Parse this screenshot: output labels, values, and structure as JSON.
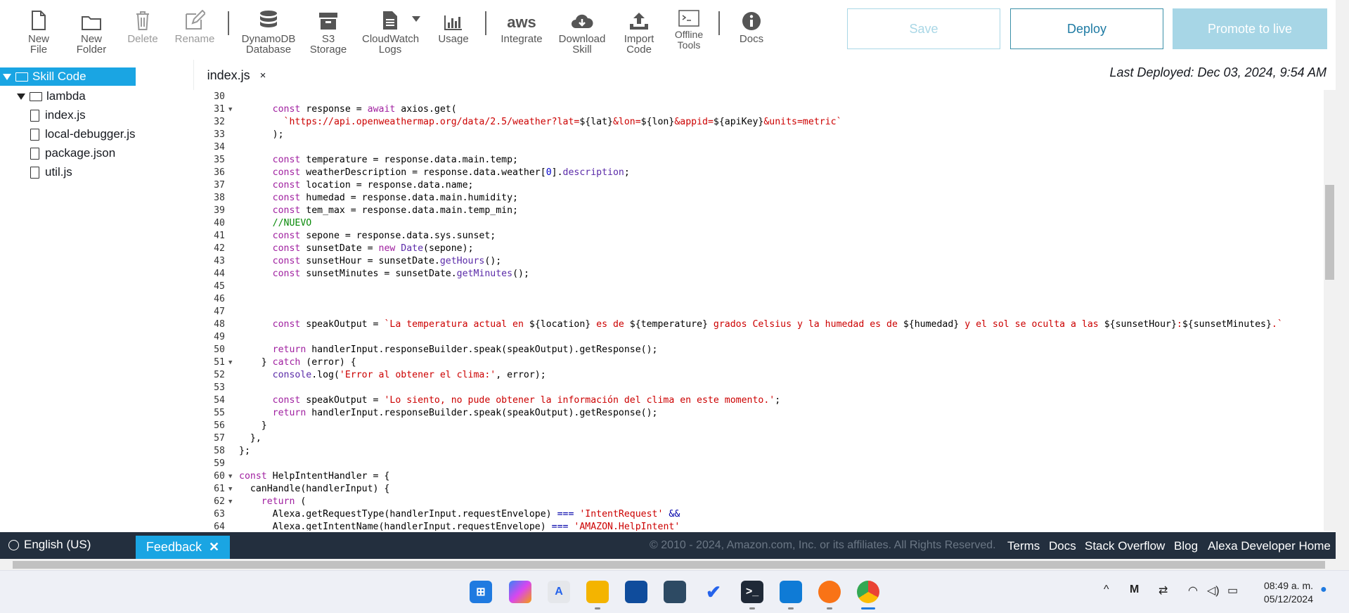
{
  "toolbar": {
    "new_file": "New\nFile",
    "new_folder": "New\nFolder",
    "delete": "Delete",
    "rename": "Rename",
    "dynamodb": "DynamoDB\nDatabase",
    "s3": "S3\nStorage",
    "cloudwatch": "CloudWatch\nLogs",
    "usage": "Usage",
    "integrate": "Integrate",
    "aws_logo_text": "aws",
    "download": "Download\nSkill",
    "import": "Import\nCode",
    "offline": "Offline\nTools",
    "docs": "Docs",
    "save": "Save",
    "deploy": "Deploy",
    "promote": "Promote to live"
  },
  "tree": {
    "root": "Skill Code",
    "folder": "lambda",
    "files": [
      "index.js",
      "local-debugger.js",
      "package.json",
      "util.js"
    ]
  },
  "editor": {
    "tab": "index.js",
    "tab_close": "×",
    "last_deployed": "Last Deployed: Dec 03, 2024, 9:54 AM",
    "lines": [
      {
        "n": "30",
        "fold": false,
        "html": ""
      },
      {
        "n": "31",
        "fold": true,
        "html": "      <span class='k'>const</span> response = <span class='k'>await</span> axios.get("
      },
      {
        "n": "32",
        "fold": false,
        "html": "        <span class='s'>`https://api.openweathermap.org/data/2.5/weather?lat=</span>${lat}<span class='s'>&amp;lon=</span>${lon}<span class='s'>&amp;appid=</span>${apiKey}<span class='s'>&amp;units=metric`</span>"
      },
      {
        "n": "33",
        "fold": false,
        "html": "      );"
      },
      {
        "n": "34",
        "fold": false,
        "html": ""
      },
      {
        "n": "35",
        "fold": false,
        "html": "      <span class='k'>const</span> temperature = response.data.main.temp;"
      },
      {
        "n": "36",
        "fold": false,
        "html": "      <span class='k'>const</span> weatherDescription = response.data.weather[<span class='n'>0</span>].<span class='f'>description</span>;"
      },
      {
        "n": "37",
        "fold": false,
        "html": "      <span class='k'>const</span> location = response.data.name;"
      },
      {
        "n": "38",
        "fold": false,
        "html": "      <span class='k'>const</span> humedad = response.data.main.humidity;"
      },
      {
        "n": "39",
        "fold": false,
        "html": "      <span class='k'>const</span> tem_max = response.data.main.temp_min;"
      },
      {
        "n": "40",
        "fold": false,
        "html": "      <span class='c'>//NUEVO</span>"
      },
      {
        "n": "41",
        "fold": false,
        "html": "      <span class='k'>const</span> sepone = response.data.sys.sunset;"
      },
      {
        "n": "42",
        "fold": false,
        "html": "      <span class='k'>const</span> sunsetDate = <span class='k'>new</span> <span class='f'>Date</span>(sepone);"
      },
      {
        "n": "43",
        "fold": false,
        "html": "      <span class='k'>const</span> sunsetHour = sunsetDate.<span class='f'>getHours</span>();"
      },
      {
        "n": "44",
        "fold": false,
        "html": "      <span class='k'>const</span> sunsetMinutes = sunsetDate.<span class='f'>getMinutes</span>();"
      },
      {
        "n": "45",
        "fold": false,
        "html": ""
      },
      {
        "n": "46",
        "fold": false,
        "html": ""
      },
      {
        "n": "47",
        "fold": false,
        "html": ""
      },
      {
        "n": "48",
        "fold": false,
        "html": "      <span class='k'>const</span> speakOutput = <span class='s'>`La temperatura actual en </span>${location}<span class='s'> es de </span>${temperature}<span class='s'> grados Celsius y la humedad es de </span>${humedad}<span class='s'> y el sol se oculta a las </span>${sunsetHour}<span class='s'>:</span>${sunsetMinutes}<span class='s'>.`</span>"
      },
      {
        "n": "49",
        "fold": false,
        "html": ""
      },
      {
        "n": "50",
        "fold": false,
        "html": "      <span class='k'>return</span> handlerInput.responseBuilder.speak(speakOutput).getResponse();"
      },
      {
        "n": "51",
        "fold": true,
        "html": "    } <span class='k'>catch</span> (error) {"
      },
      {
        "n": "52",
        "fold": false,
        "html": "      <span class='f'>console</span>.log(<span class='s'>'Error al obtener el clima:'</span>, error);"
      },
      {
        "n": "53",
        "fold": false,
        "html": ""
      },
      {
        "n": "54",
        "fold": false,
        "html": "      <span class='k'>const</span> speakOutput = <span class='s'>'Lo siento, no pude obtener la información del clima en este momento.'</span>;"
      },
      {
        "n": "55",
        "fold": false,
        "html": "      <span class='k'>return</span> handlerInput.responseBuilder.speak(speakOutput).getResponse();"
      },
      {
        "n": "56",
        "fold": false,
        "html": "    }"
      },
      {
        "n": "57",
        "fold": false,
        "html": "  },"
      },
      {
        "n": "58",
        "fold": false,
        "html": "};"
      },
      {
        "n": "59",
        "fold": false,
        "html": ""
      },
      {
        "n": "60",
        "fold": true,
        "html": "<span class='k'>const</span> HelpIntentHandler = {"
      },
      {
        "n": "61",
        "fold": true,
        "html": "  canHandle(handlerInput) {"
      },
      {
        "n": "62",
        "fold": true,
        "html": "    <span class='k'>return</span> ("
      },
      {
        "n": "63",
        "fold": false,
        "html": "      Alexa.getRequestType(handlerInput.requestEnvelope) <span class='o'>===</span> <span class='s'>'IntentRequest'</span> <span class='o'>&amp;&amp;</span>"
      },
      {
        "n": "64",
        "fold": false,
        "html": "      Alexa.getIntentName(handlerInput.requestEnvelope) <span class='o'>===</span> <span class='s'>'AMAZON.HelpIntent'</span>"
      }
    ]
  },
  "footer": {
    "language": "English (US)",
    "feedback": "Feedback",
    "copyright": "© 2010 - 2024, Amazon.com, Inc. or its affiliates. All Rights Reserved.",
    "links": [
      "Terms",
      "Docs",
      "Stack Overflow",
      "Blog",
      "Alexa Developer Home"
    ]
  },
  "taskbar": {
    "time": "08:49 a. m.",
    "date": "05/12/2024"
  }
}
